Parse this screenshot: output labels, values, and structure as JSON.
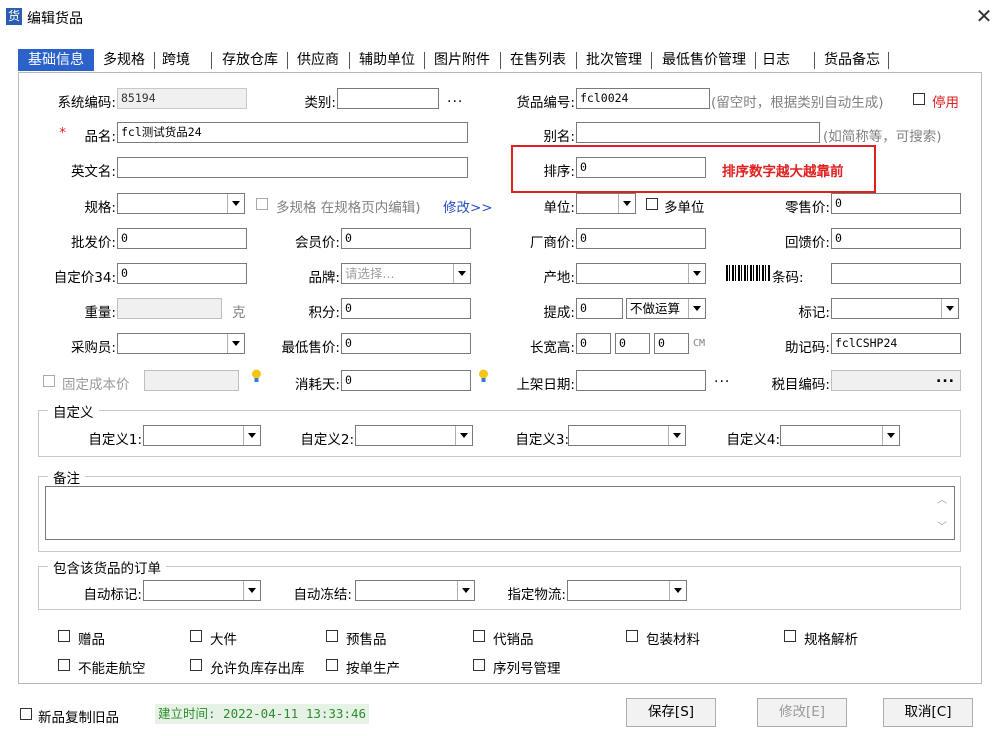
{
  "window": {
    "title": "编辑货品",
    "close": "✕",
    "app_icon": "货"
  },
  "tabs": [
    "基础信息",
    "多规格",
    "跨境",
    "存放仓库",
    "供应商",
    "辅助单位",
    "图片附件",
    "在售列表",
    "批次管理",
    "最低售价管理",
    "日志",
    "货品备忘"
  ],
  "form": {
    "system_code": {
      "label": "系统编码:",
      "value": "85194"
    },
    "category": {
      "label": "类别:",
      "value": "",
      "more": "..."
    },
    "goods_no": {
      "label": "货品编号:",
      "value": "fcl0024",
      "hint": "(留空时，根据类别自动生成)",
      "disable_label": "停用"
    },
    "name": {
      "required": "*",
      "label": "品名:",
      "value": "fcl测试货品24"
    },
    "alias": {
      "label": "别名:",
      "value": "",
      "hint": "(如简称等，可搜索)"
    },
    "en_name": {
      "label": "英文名:",
      "value": ""
    },
    "sort": {
      "label": "排序:",
      "value": "0",
      "note": "排序数字越大越靠前"
    },
    "spec": {
      "label": "规格:",
      "value": "",
      "multi_spec": "多规格 在规格页内编辑)",
      "modify_link": "修改>>"
    },
    "unit": {
      "label": "单位:",
      "value": "",
      "multi_unit": "多单位"
    },
    "retail_price": {
      "label": "零售价:",
      "value": "0"
    },
    "wholesale_price": {
      "label": "批发价:",
      "value": "0"
    },
    "member_price": {
      "label": "会员价:",
      "value": "0"
    },
    "factory_price": {
      "label": "厂商价:",
      "value": "0"
    },
    "return_price": {
      "label": "回馈价:",
      "value": "0"
    },
    "custom_price34": {
      "label": "自定价34:",
      "value": "0"
    },
    "brand": {
      "label": "品牌:",
      "placeholder": "请选择..."
    },
    "origin": {
      "label": "产地:",
      "value": ""
    },
    "barcode": {
      "label": "条码:",
      "value": ""
    },
    "weight": {
      "label": "重量:",
      "value": "",
      "unit": "克"
    },
    "points": {
      "label": "积分:",
      "value": "0"
    },
    "commission": {
      "label": "提成:",
      "value": "0",
      "mode": "不做运算"
    },
    "mark": {
      "label": "标记:",
      "value": ""
    },
    "buyer": {
      "label": "采购员:",
      "value": ""
    },
    "min_price": {
      "label": "最低售价:",
      "value": "0"
    },
    "dimensions": {
      "label": "长宽高:",
      "l": "0",
      "w": "0",
      "h": "0",
      "unit": "CM"
    },
    "mnemonic": {
      "label": "助记码:",
      "value": "fclCSHP24"
    },
    "fixed_cost": {
      "label": "固定成本价",
      "value": ""
    },
    "consume_days": {
      "label": "消耗天:",
      "value": "0"
    },
    "shelf_date": {
      "label": "上架日期:",
      "value": "",
      "more": "..."
    },
    "tax_code": {
      "label": "税目编码:",
      "value": "",
      "more": "..."
    }
  },
  "custom_group": {
    "title": "自定义",
    "fields": [
      "自定义1:",
      "自定义2:",
      "自定义3:",
      "自定义4:"
    ]
  },
  "remark_group": {
    "title": "备注",
    "value": ""
  },
  "order_group": {
    "title": "包含该货品的订单",
    "auto_mark": "自动标记:",
    "auto_freeze": "自动冻结:",
    "logistics": "指定物流:"
  },
  "checkboxes": {
    "row1": [
      "赠品",
      "大件",
      "预售品",
      "代销品",
      "包装材料",
      "规格解析"
    ],
    "row2": [
      "不能走航空",
      "允许负库存出库",
      "按单生产",
      "序列号管理"
    ]
  },
  "footer": {
    "copy_old": "新品复制旧品",
    "created": "建立时间: 2022-04-11 13:33:46",
    "save": "保存[S]",
    "modify": "修改[E]",
    "cancel": "取消[C]"
  },
  "colors": {
    "accent": "#2a62c9",
    "red": "#e02020",
    "grey_text": "#808080"
  }
}
